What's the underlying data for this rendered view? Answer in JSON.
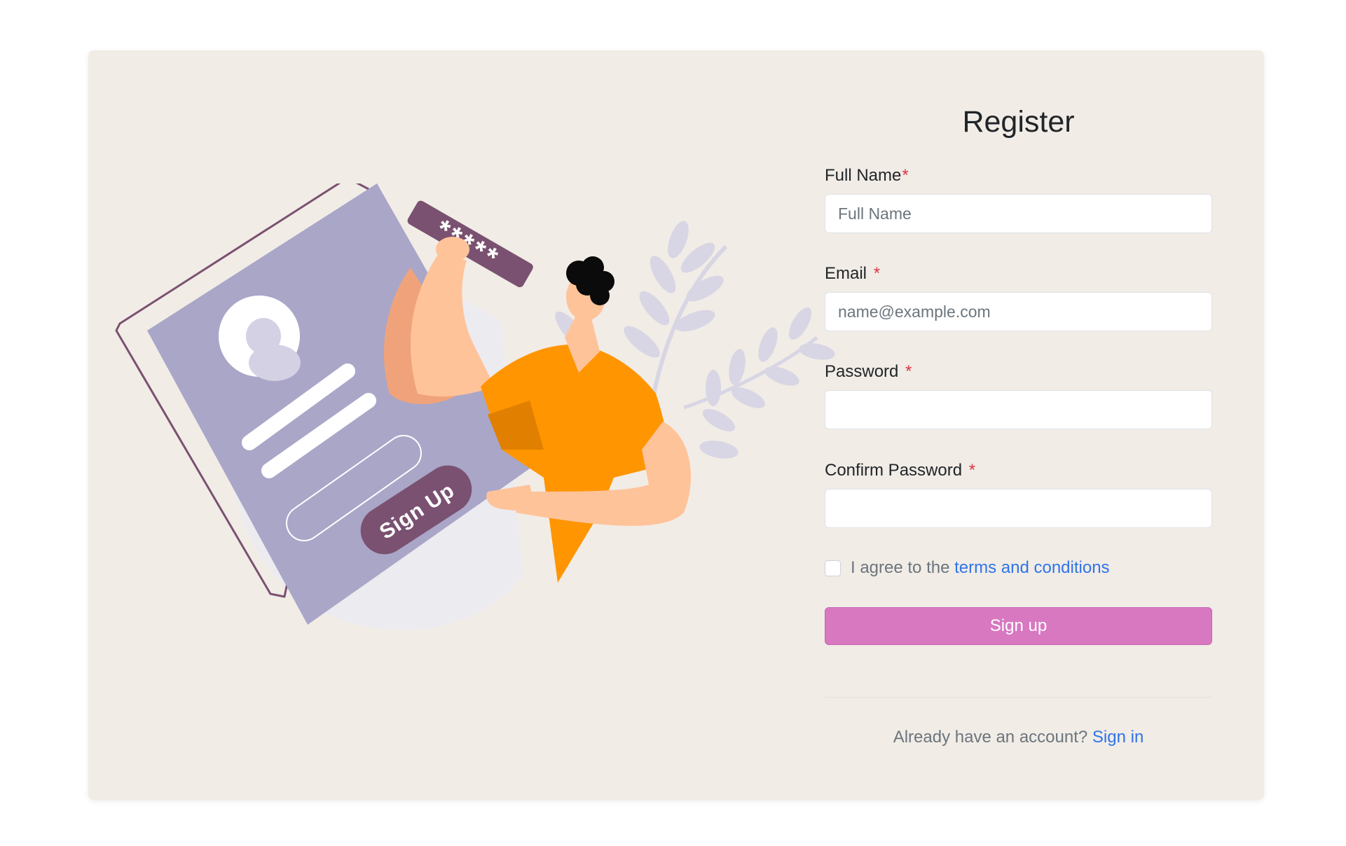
{
  "form": {
    "title": "Register",
    "fields": [
      {
        "label": "Full Name",
        "required_mark": "*",
        "placeholder": "Full Name",
        "value": "",
        "type": "text"
      },
      {
        "label": "Email",
        "required_mark": "*",
        "placeholder": "name@example.com",
        "value": "",
        "type": "email"
      },
      {
        "label": "Password",
        "required_mark": "*",
        "placeholder": "",
        "value": "",
        "type": "password"
      },
      {
        "label": "Confirm Password",
        "required_mark": "*",
        "placeholder": "",
        "value": "",
        "type": "password"
      }
    ],
    "agree_prefix": "I agree to the",
    "agree_link": "terms and conditions",
    "agree_checked": false,
    "submit_label": "Sign up",
    "signin_prefix": "Already have an account?",
    "signin_link": "Sign in"
  },
  "illustration": {
    "password_mask": "*****",
    "button_text": "Sign Up"
  },
  "colors": {
    "card_bg": "#f1ece6",
    "accent": "#d878c1",
    "link": "#2f74e8",
    "required": "#dc3545",
    "phone": "#a9a6c8",
    "plum": "#7a5170",
    "shirt": "#ff9500",
    "skin": "#ffc39a"
  }
}
